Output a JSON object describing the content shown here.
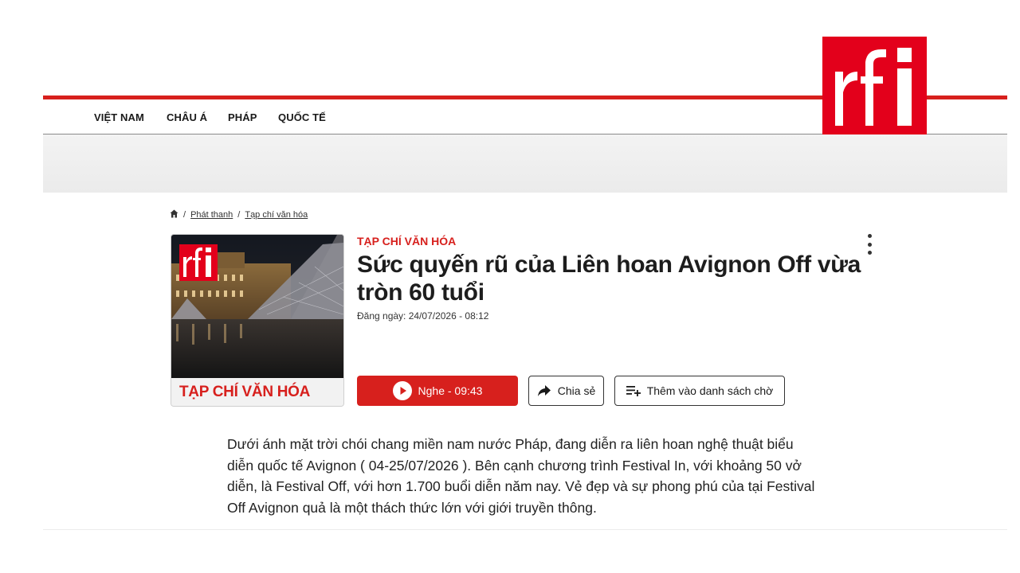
{
  "brand": {
    "logo_text": "rfi",
    "color": "#d7201d",
    "logo_color": "#e3001b"
  },
  "nav": {
    "items": [
      {
        "label": "VIỆT NAM"
      },
      {
        "label": "CHÂU Á"
      },
      {
        "label": "PHÁP"
      },
      {
        "label": "QUỐC TẾ"
      }
    ]
  },
  "breadcrumb": {
    "home_icon": "home-icon",
    "items": [
      {
        "label": "Phát thanh"
      },
      {
        "label": "Tạp chí văn hóa"
      }
    ]
  },
  "thumbnail": {
    "logo_text": "rfi",
    "caption": "TẠP CHÍ VĂN HÓA"
  },
  "article": {
    "kicker": "TẠP CHÍ VĂN HÓA",
    "title": "Sức quyến rũ của Liên hoan Avignon Off vừa tròn 60 tuổi",
    "date": "Đăng ngày: 24/07/2026 - 08:12",
    "lead": "Dưới ánh mặt trời chói chang miền nam nước Pháp, đang diễn ra liên hoan nghệ thuật biểu diễn quốc tế Avignon ( 04-25/07/2026 ). Bên cạnh chương trình Festival In, với khoảng 50 vở diễn, là Festival Off, với hơn 1.700 buổi diễn năm nay. Vẻ đẹp và sự phong phú của tại Festival Off Avignon quả là một thách thức lớn với giới truyền thông."
  },
  "actions": {
    "play_label": "Nghe - 09:43",
    "share_label": "Chia sẻ",
    "queue_label": "Thêm vào danh sách chờ"
  }
}
